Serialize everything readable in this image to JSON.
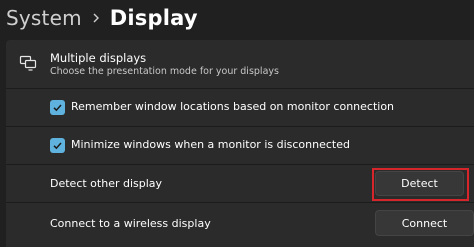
{
  "header": {
    "parent": "System",
    "current": "Display"
  },
  "multiple_displays": {
    "icon": "multiple-monitors-icon",
    "title": "Multiple displays",
    "subtitle": "Choose the presentation mode for your displays"
  },
  "options": {
    "remember_locations": {
      "label": "Remember window locations based on monitor connection",
      "checked": true
    },
    "minimize_windows": {
      "label": "Minimize windows when a monitor is disconnected",
      "checked": true
    }
  },
  "detect": {
    "label": "Detect other display",
    "button": "Detect"
  },
  "wireless": {
    "label": "Connect to a wireless display",
    "button": "Connect"
  },
  "colors": {
    "background": "#202020",
    "panel": "#2b2b2b",
    "accent": "#5fb2dd",
    "highlight": "#d7262b"
  }
}
